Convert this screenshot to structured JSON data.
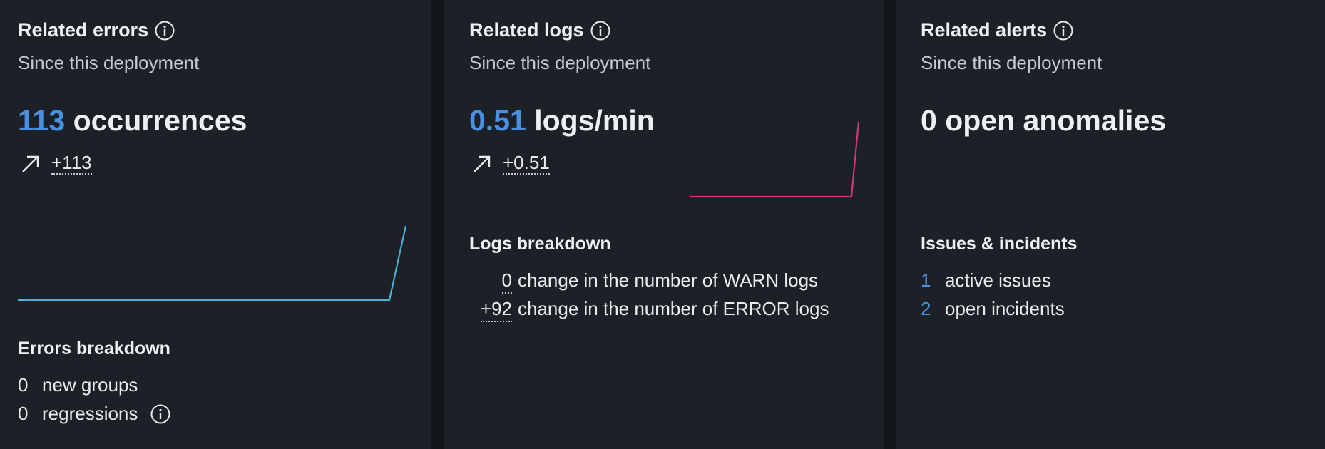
{
  "errors": {
    "title": "Related errors",
    "subtitle": "Since this deployment",
    "metric_value": "113",
    "metric_unit": "occurrences",
    "trend_value": "+113",
    "sparkline_color": "#4fb0d6",
    "breakdown_title": "Errors breakdown",
    "breakdown": [
      {
        "value": "0",
        "label": "new groups"
      },
      {
        "value": "0",
        "label": "regressions"
      }
    ]
  },
  "logs": {
    "title": "Related logs",
    "subtitle": "Since this deployment",
    "metric_value": "0.51",
    "metric_unit": "logs/min",
    "trend_value": "+0.51",
    "sparkline_color": "#d0357a",
    "breakdown_title": "Logs breakdown",
    "breakdown": [
      {
        "value": "0",
        "label": "change in the number of WARN logs"
      },
      {
        "value": "+92",
        "label": "change in the number of ERROR logs"
      }
    ]
  },
  "alerts": {
    "title": "Related alerts",
    "subtitle": "Since this deployment",
    "metric_text": "0 open anomalies",
    "section_title": "Issues & incidents",
    "items": [
      {
        "value": "1",
        "label": "active issues"
      },
      {
        "value": "2",
        "label": "open incidents"
      }
    ]
  },
  "colors": {
    "accent": "#4a90e2",
    "card_bg": "#1b2127",
    "page_bg": "#101619"
  }
}
